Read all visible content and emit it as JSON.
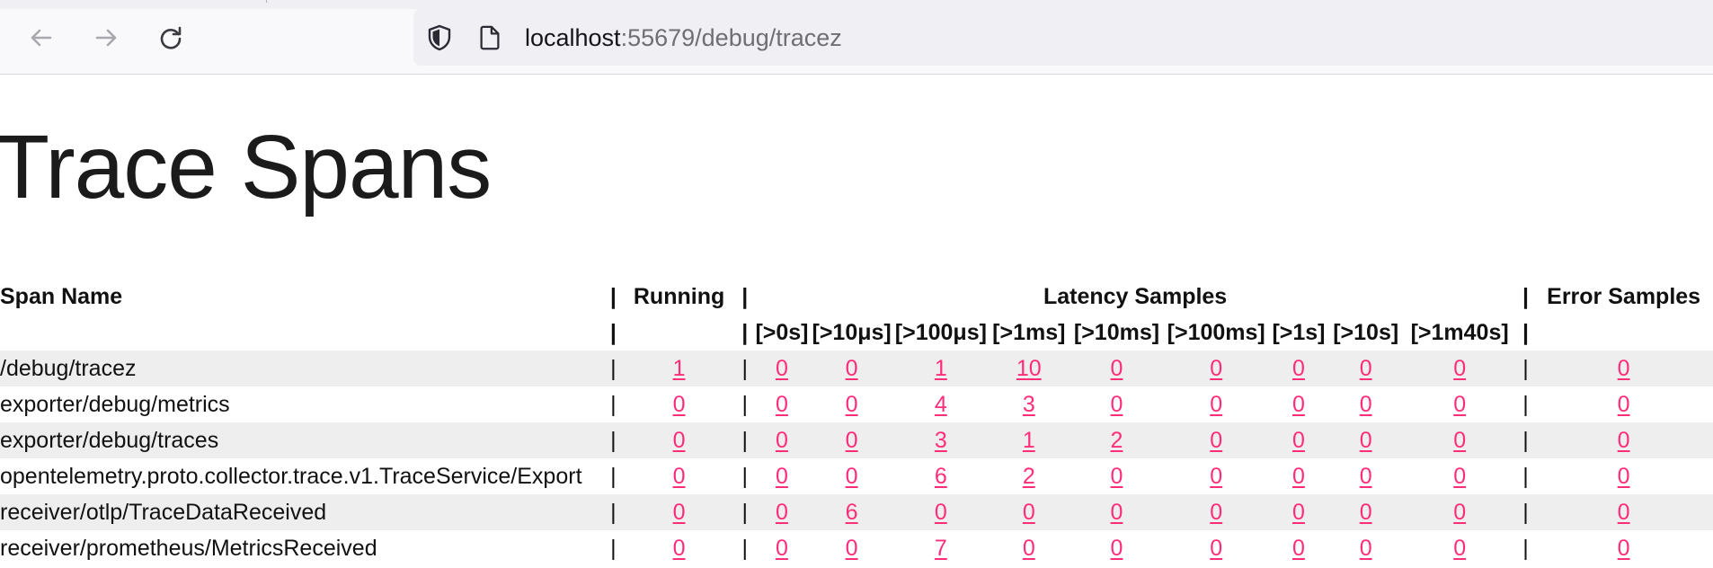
{
  "browser": {
    "url_host": "localhost",
    "url_path": ":55679/debug/tracez"
  },
  "icons": {
    "back": "arrow-left-icon",
    "forward": "arrow-right-icon",
    "reload": "reload-icon",
    "tracking": "shield-icon",
    "page": "page-icon"
  },
  "page": {
    "title": "Trace Spans"
  },
  "table": {
    "headers": {
      "span_name": "Span Name",
      "running": "Running",
      "latency": "Latency Samples",
      "error": "Error Samples",
      "separator": "|"
    },
    "latency_buckets": [
      "[>0s]",
      "[>10μs]",
      "[>100μs]",
      "[>1ms]",
      "[>10ms]",
      "[>100ms]",
      "[>1s]",
      "[>10s]",
      "[>1m40s]"
    ],
    "rows": [
      {
        "name": "/debug/tracez",
        "running": "1",
        "latency": [
          "0",
          "0",
          "1",
          "10",
          "0",
          "0",
          "0",
          "0",
          "0"
        ],
        "error": "0"
      },
      {
        "name": "exporter/debug/metrics",
        "running": "0",
        "latency": [
          "0",
          "0",
          "4",
          "3",
          "0",
          "0",
          "0",
          "0",
          "0"
        ],
        "error": "0"
      },
      {
        "name": "exporter/debug/traces",
        "running": "0",
        "latency": [
          "0",
          "0",
          "3",
          "1",
          "2",
          "0",
          "0",
          "0",
          "0"
        ],
        "error": "0"
      },
      {
        "name": "opentelemetry.proto.collector.trace.v1.TraceService/Export",
        "running": "0",
        "latency": [
          "0",
          "0",
          "6",
          "2",
          "0",
          "0",
          "0",
          "0",
          "0"
        ],
        "error": "0"
      },
      {
        "name": "receiver/otlp/TraceDataReceived",
        "running": "0",
        "latency": [
          "0",
          "6",
          "0",
          "0",
          "0",
          "0",
          "0",
          "0",
          "0"
        ],
        "error": "0"
      },
      {
        "name": "receiver/prometheus/MetricsReceived",
        "running": "0",
        "latency": [
          "0",
          "0",
          "7",
          "0",
          "0",
          "0",
          "0",
          "0",
          "0"
        ],
        "error": "0"
      }
    ]
  },
  "colors": {
    "link": "#ff2d7a",
    "row_alt": "#eeeeee",
    "toolbar": "#f9f9fb",
    "urlbar": "#f0f0f4"
  }
}
